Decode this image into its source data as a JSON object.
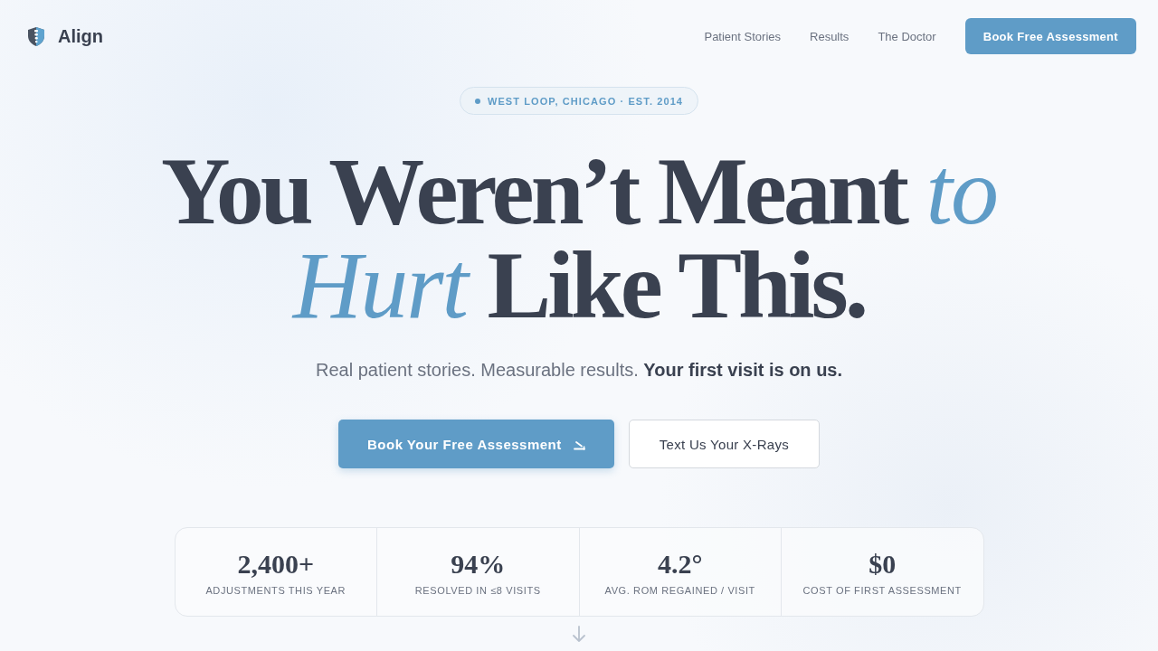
{
  "nav": {
    "brand": "Align",
    "links": [
      "Patient Stories",
      "Results",
      "The Doctor"
    ],
    "cta": "Book Free Assessment"
  },
  "hero": {
    "badge": "WEST LOOP, CHICAGO · EST. 2014",
    "headline": [
      "You Weren’t Meant *to*",
      "*Hurt* Like This."
    ],
    "subtitle": "Real patient stories. Measurable results. **Your first visit is on us.**",
    "buttons": [
      {
        "label": "Book Your Free Assessment",
        "kind": "primary"
      },
      {
        "label": "Text Us Your X-Rays",
        "kind": "secondary"
      }
    ]
  },
  "stats": [
    {
      "value": "2,400+",
      "label": "ADJUSTMENTS THIS YEAR"
    },
    {
      "value": "94%",
      "label": "RESOLVED IN ≤8 VISITS"
    },
    {
      "value": "4.2°",
      "label": "AVG. ROM REGAINED / VISIT"
    },
    {
      "value": "$0",
      "label": "COST OF FIRST ASSESSMENT"
    }
  ]
}
